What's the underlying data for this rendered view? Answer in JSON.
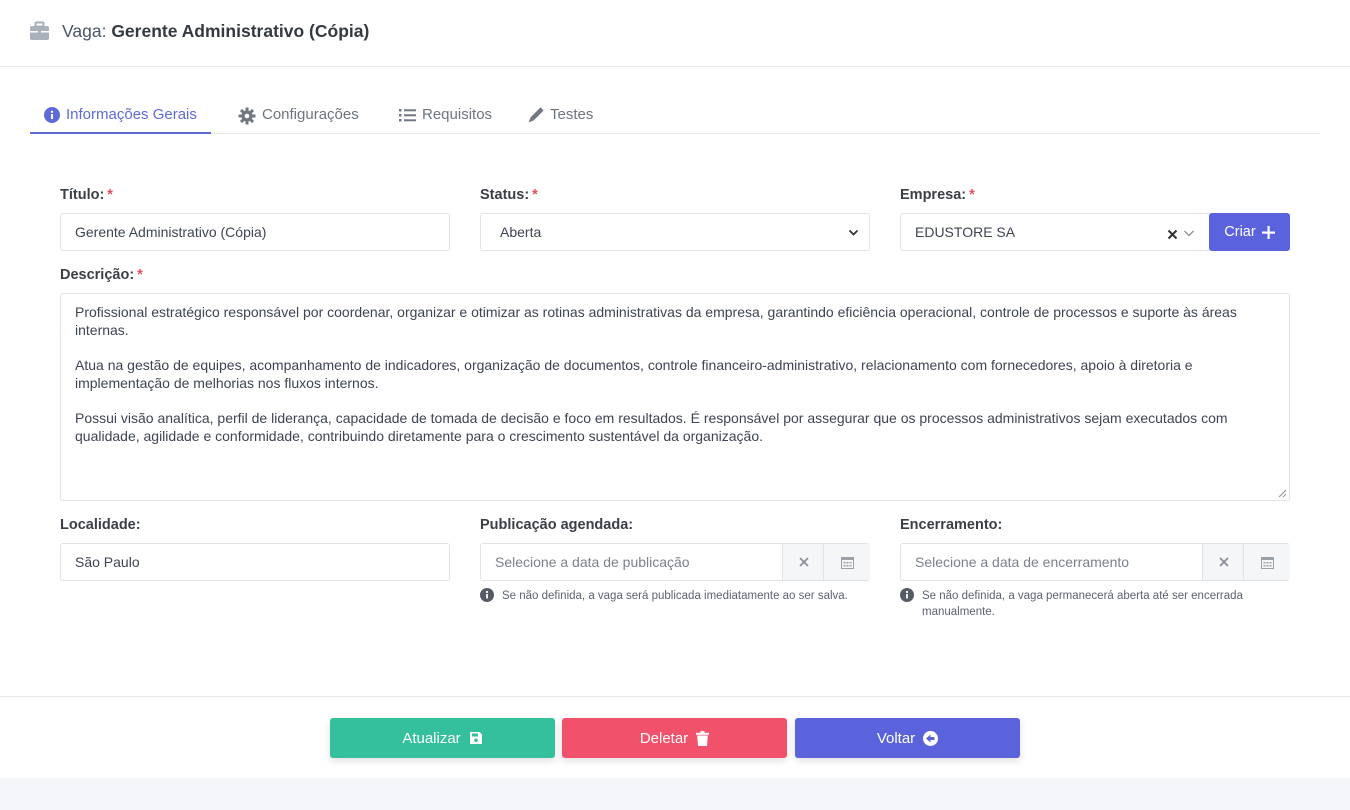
{
  "header": {
    "prefix": "Vaga:",
    "job_title": "Gerente Administrativo (Cópia)",
    "icon": "briefcase-icon"
  },
  "tabs": [
    {
      "label": "Informações Gerais",
      "icon": "info-icon",
      "active": true
    },
    {
      "label": "Configurações",
      "icon": "gear-icon",
      "active": false
    },
    {
      "label": "Requisitos",
      "icon": "list-icon",
      "active": false
    },
    {
      "label": "Testes",
      "icon": "pencil-icon",
      "active": false
    }
  ],
  "form": {
    "titulo": {
      "label": "Título:",
      "value": "Gerente Administrativo (Cópia)"
    },
    "status": {
      "label": "Status:",
      "value": "Aberta"
    },
    "empresa": {
      "label": "Empresa:",
      "value": "EDUSTORE SA",
      "create_label": "Criar"
    },
    "descricao": {
      "label": "Descrição:",
      "paragraphs": [
        "Profissional estratégico responsável por coordenar, organizar e otimizar as rotinas administrativas da empresa, garantindo eficiência operacional, controle de processos e suporte às áreas internas.",
        "Atua na gestão de equipes, acompanhamento de indicadores, organização de documentos, controle financeiro-administrativo, relacionamento com fornecedores, apoio à diretoria e implementação de melhorias nos fluxos internos.",
        "Possui visão analítica, perfil de liderança, capacidade de tomada de decisão e foco em resultados. É responsável por assegurar que os processos administrativos sejam executados com qualidade, agilidade e conformidade, contribuindo diretamente para o crescimento sustentável da organização."
      ]
    },
    "localidade": {
      "label": "Localidade:",
      "value": "São Paulo"
    },
    "publicacao": {
      "label": "Publicação agendada:",
      "placeholder": "Selecione a data de publicação",
      "hint": "Se não definida, a vaga será publicada imediatamente ao ser salva."
    },
    "encerramento": {
      "label": "Encerramento:",
      "placeholder": "Selecione a data de encerramento",
      "hint": "Se não definida, a vaga permanecerá aberta até ser encerrada manualmente."
    }
  },
  "footer": {
    "update_label": "Atualizar",
    "delete_label": "Deletar",
    "back_label": "Voltar"
  },
  "colors": {
    "primary": "#5a63dc",
    "success": "#34c09c",
    "danger": "#f2516b",
    "required": "#e04e5f"
  }
}
